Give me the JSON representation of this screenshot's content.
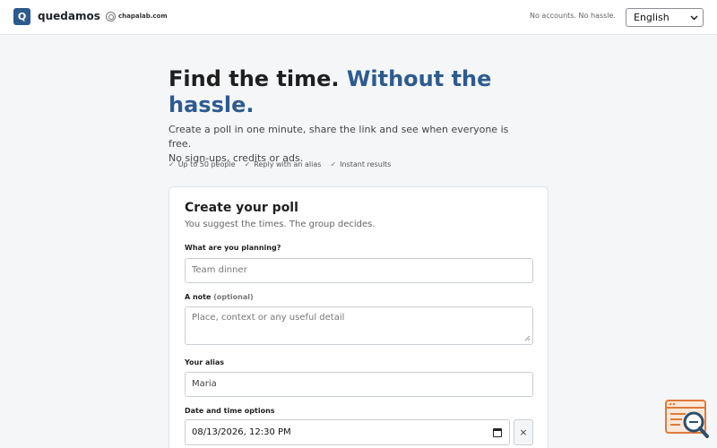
{
  "header": {
    "logo_letter": "Q",
    "brand": "quedamos",
    "separator": "·",
    "maker": "chapalab.com",
    "tagline": "No accounts. No hassle.",
    "language": "English"
  },
  "hero": {
    "title_plain": "Find the time.",
    "title_accent": "Without the hassle.",
    "subtitle_line1": "Create a poll in one minute, share the link and see when everyone is free.",
    "subtitle_line2": "No sign-ups, credits or ads.",
    "features": [
      {
        "check": "✓",
        "text": "Up to 50 people"
      },
      {
        "check": "✓",
        "text": "Reply with an alias"
      },
      {
        "check": "✓",
        "text": "Instant results"
      }
    ]
  },
  "form": {
    "title": "Create your poll",
    "subtitle": "You suggest the times. The group decides.",
    "plan_label": "What are you planning?",
    "plan_placeholder": "Team dinner",
    "note_label": "A note",
    "note_optional": "(optional)",
    "note_placeholder": "Place, context or any useful detail",
    "alias_label": "Your alias",
    "alias_value": "Maria",
    "datetime_label": "Date and time options",
    "datetime_value": "08/13/2026, 12:30 PM",
    "remove_label": "×"
  },
  "colors": {
    "accent": "#2e5b8f",
    "logo_bg": "#2c5a8c",
    "page_bg": "#f4f6f8"
  },
  "icons": {
    "calendar": "calendar-icon",
    "help": "help-widget-icon"
  }
}
